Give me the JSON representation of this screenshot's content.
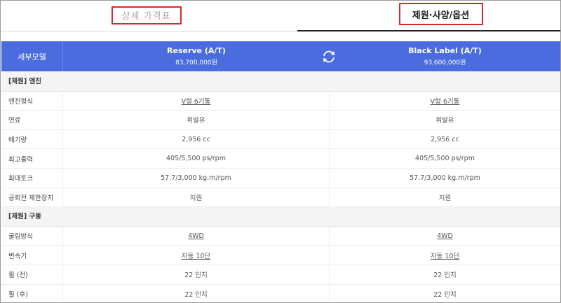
{
  "tabs": {
    "price_label": "상세 가격표",
    "spec_label": "제원·사양/옵션"
  },
  "colors": {
    "header_bg": "#4a6cde",
    "highlight_box": "#e0262b"
  },
  "header": {
    "label": "세부모델",
    "model_a": {
      "name": "Reserve (A/T)",
      "price": "83,700,000원"
    },
    "model_b": {
      "name": "Black Label (A/T)",
      "price": "93,600,000원"
    },
    "swap_icon": "refresh-icon"
  },
  "sections": [
    {
      "title": "[제원] 엔진",
      "rows": [
        {
          "label": "엔진형식",
          "a": "V형 6기통",
          "b": "V형 6기통",
          "link": true
        },
        {
          "label": "연료",
          "a": "휘발유",
          "b": "휘발유",
          "link": false
        },
        {
          "label": "배기량",
          "a": "2,956 cc",
          "b": "2,956 cc",
          "link": false
        },
        {
          "label": "최고출력",
          "a": "405/5,500 ps/rpm",
          "b": "405/5,500 ps/rpm",
          "link": false
        },
        {
          "label": "최대토크",
          "a": "57.7/3,000 kg.m/rpm",
          "b": "57.7/3,000 kg.m/rpm",
          "link": false
        },
        {
          "label": "공회전 제한장치",
          "a": "지원",
          "b": "지원",
          "link": false
        }
      ]
    },
    {
      "title": "[제원] 구동",
      "rows": [
        {
          "label": "굴림방식",
          "a": "4WD",
          "b": "4WD",
          "link": true
        },
        {
          "label": "변속기",
          "a": "자동 10단",
          "b": "자동 10단",
          "link": true
        },
        {
          "label": "휠 (전)",
          "a": "22 인치",
          "b": "22 인치",
          "link": false
        },
        {
          "label": "휠 (후)",
          "a": "22 인치",
          "b": "22 인치",
          "link": false
        }
      ]
    }
  ]
}
